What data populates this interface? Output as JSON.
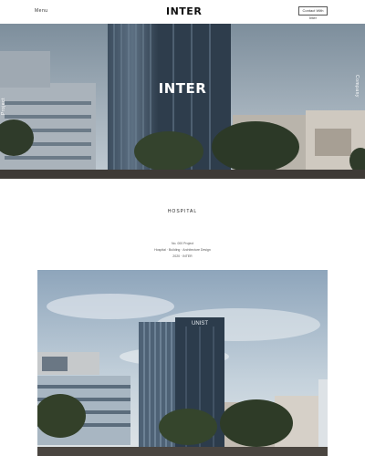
{
  "header": {
    "menu_label": "Menu",
    "logo_text": "INTER",
    "contact_label": "Contact With Inter"
  },
  "hero": {
    "title": "INTER",
    "side_left_label": "Project",
    "side_right_label": "Company"
  },
  "section": {
    "heading": "HOSPITAL",
    "info_lines": [
      "No. 000 Project",
      "Hospital · Building · Architecture Design",
      "2020 · INTER"
    ]
  },
  "photo": {
    "sign_text": "UNIST"
  },
  "colors": {
    "accent": "#111111",
    "sky_top": "#8fa2b4",
    "sky_bottom": "#cfd7de"
  }
}
